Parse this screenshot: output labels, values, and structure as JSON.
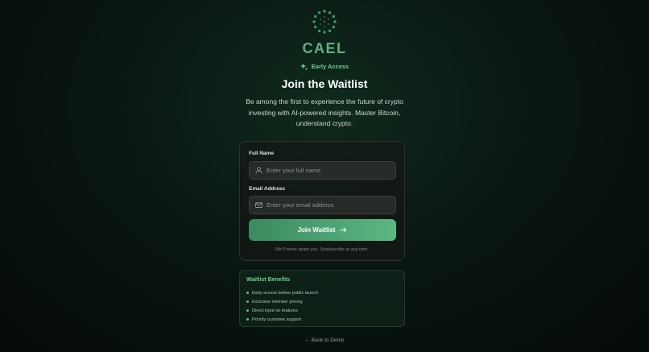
{
  "brand": {
    "name": "CAEL",
    "logo_icon": "radial-dots-logo"
  },
  "badge": {
    "label": "Early Access",
    "icon": "sparkles-icon"
  },
  "heading": {
    "title": "Join the Waitlist",
    "subtitle": "Be among the first to experience the future of crypto investing with AI-powered insights. Master Bitcoin, understand crypto."
  },
  "form": {
    "name_label": "Full Name",
    "name_placeholder": "Enter your full name",
    "name_value": "",
    "email_label": "Email Address",
    "email_placeholder": "Enter your email address",
    "email_value": "",
    "submit_label": "Join Waitlist",
    "disclaimer": "We'll never spam you. Unsubscribe at any time."
  },
  "benefits": {
    "title": "Waitlist Benefits",
    "items": [
      "Early access before public launch",
      "Exclusive member pricing",
      "Direct input on features",
      "Priority customer support"
    ]
  },
  "footer": {
    "back_link": "← Back to Demo"
  },
  "colors": {
    "accent": "#5bb883",
    "accent_text": "#6fcf93",
    "background": "#0a1711"
  }
}
